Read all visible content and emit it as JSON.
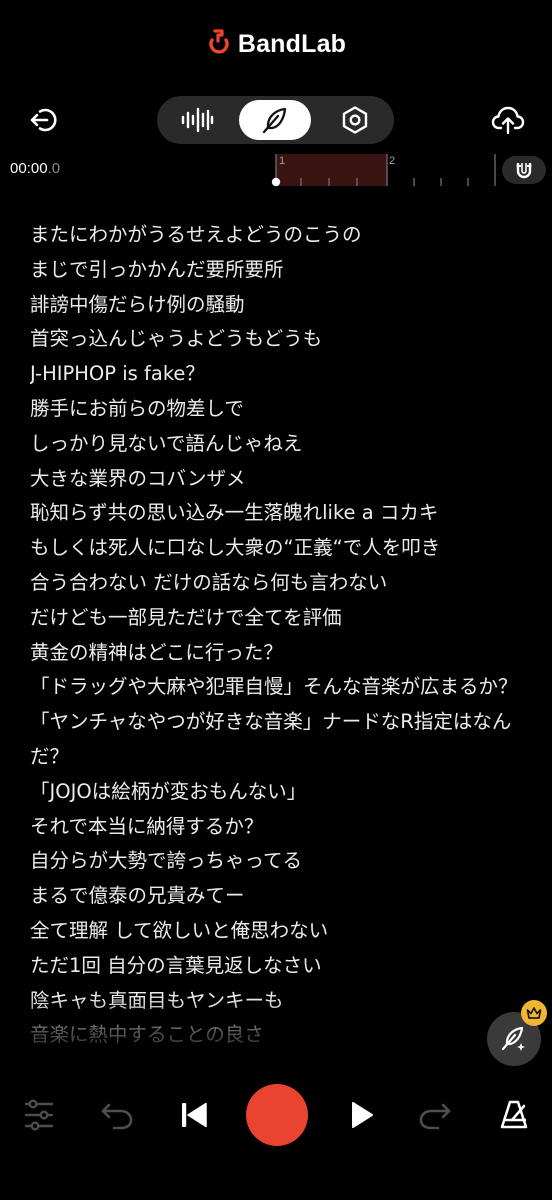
{
  "app": {
    "name": "BandLab"
  },
  "toolbar": {
    "back_icon": "exit-icon",
    "tabs": [
      {
        "icon": "waveform-icon",
        "active": false
      },
      {
        "icon": "feather-pen-icon",
        "active": true
      },
      {
        "icon": "hexagon-settings-icon",
        "active": false
      }
    ],
    "upload_icon": "cloud-upload-icon"
  },
  "timeline": {
    "time_main": "00:00",
    "time_fraction": ".0",
    "markers": [
      "1",
      "2"
    ],
    "region_color": "#3a1410",
    "magnet_icon": "magnet-icon"
  },
  "lyrics": [
    "またにわかがうるせえよどうのこうの",
    "まじで引っかかんだ要所要所",
    "誹謗中傷だらけ例の騒動",
    "首突っ込んじゃうよどうもどうも",
    "J-HIPHOP is fake？",
    "勝手にお前らの物差しで",
    "しっかり見ないで語んじゃねえ",
    "大きな業界のコバンザメ",
    "恥知らず共の思い込み一生落魄れlike a コカキ",
    "もしくは死人に口なし大衆の“正義“で人を叩き",
    "合う合わない だけの話なら何も言わない",
    "だけども一部見ただけで全てを評価",
    "黄金の精神はどこに行った？",
    "「ドラッグや大麻や犯罪自慢」そんな音楽が広まるか？",
    "「ヤンチャなやつが好きな音楽」ナードなR指定はなんだ？",
    "「JOJOは絵柄が変おもんない」",
    "それで本当に納得するか？",
    "自分らが大勢で誇っちゃってる",
    "まるで億泰の兄貴みてー",
    "全て理解 して欲しいと俺思わない",
    "ただ1回 自分の言葉見返しなさい",
    "陰キャも真面目もヤンキーも",
    "音楽に熱中することの良さ"
  ],
  "fab": {
    "icon": "ai-pen-icon",
    "badge_icon": "crown-icon",
    "badge_color": "#f2b433"
  },
  "bottom_bar": {
    "mixer_icon": "sliders-icon",
    "undo_icon": "undo-icon",
    "skip_back_icon": "skip-back-icon",
    "record_icon": "record-icon",
    "record_color": "#e8442f",
    "play_icon": "play-icon",
    "redo_icon": "redo-icon",
    "metronome_icon": "metronome-icon"
  }
}
